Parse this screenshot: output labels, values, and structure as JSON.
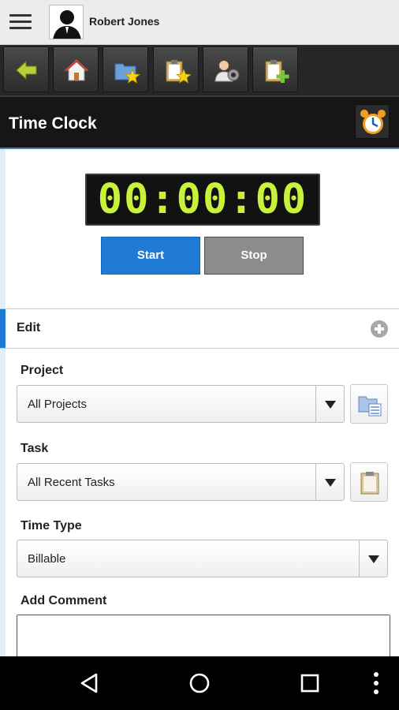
{
  "user": {
    "name": "Robert Jones"
  },
  "toolbar": {
    "icons": [
      "back-arrow-icon",
      "home-icon",
      "favorite-projects-icon",
      "favorite-tasks-icon",
      "user-settings-icon",
      "add-task-icon"
    ]
  },
  "page": {
    "title": "Time Clock"
  },
  "timer": {
    "display": "00:00:00",
    "start_label": "Start",
    "stop_label": "Stop",
    "digit_color": "#c8f23a"
  },
  "edit": {
    "label": "Edit"
  },
  "form": {
    "project_label": "Project",
    "project_value": "All Projects",
    "task_label": "Task",
    "task_value": "All Recent Tasks",
    "time_type_label": "Time Type",
    "time_type_value": "Billable",
    "comment_label": "Add Comment",
    "comment_value": ""
  },
  "colors": {
    "accent": "#1f7ad6",
    "stop_button": "#8c8c8c",
    "toolbar": "#262626"
  }
}
